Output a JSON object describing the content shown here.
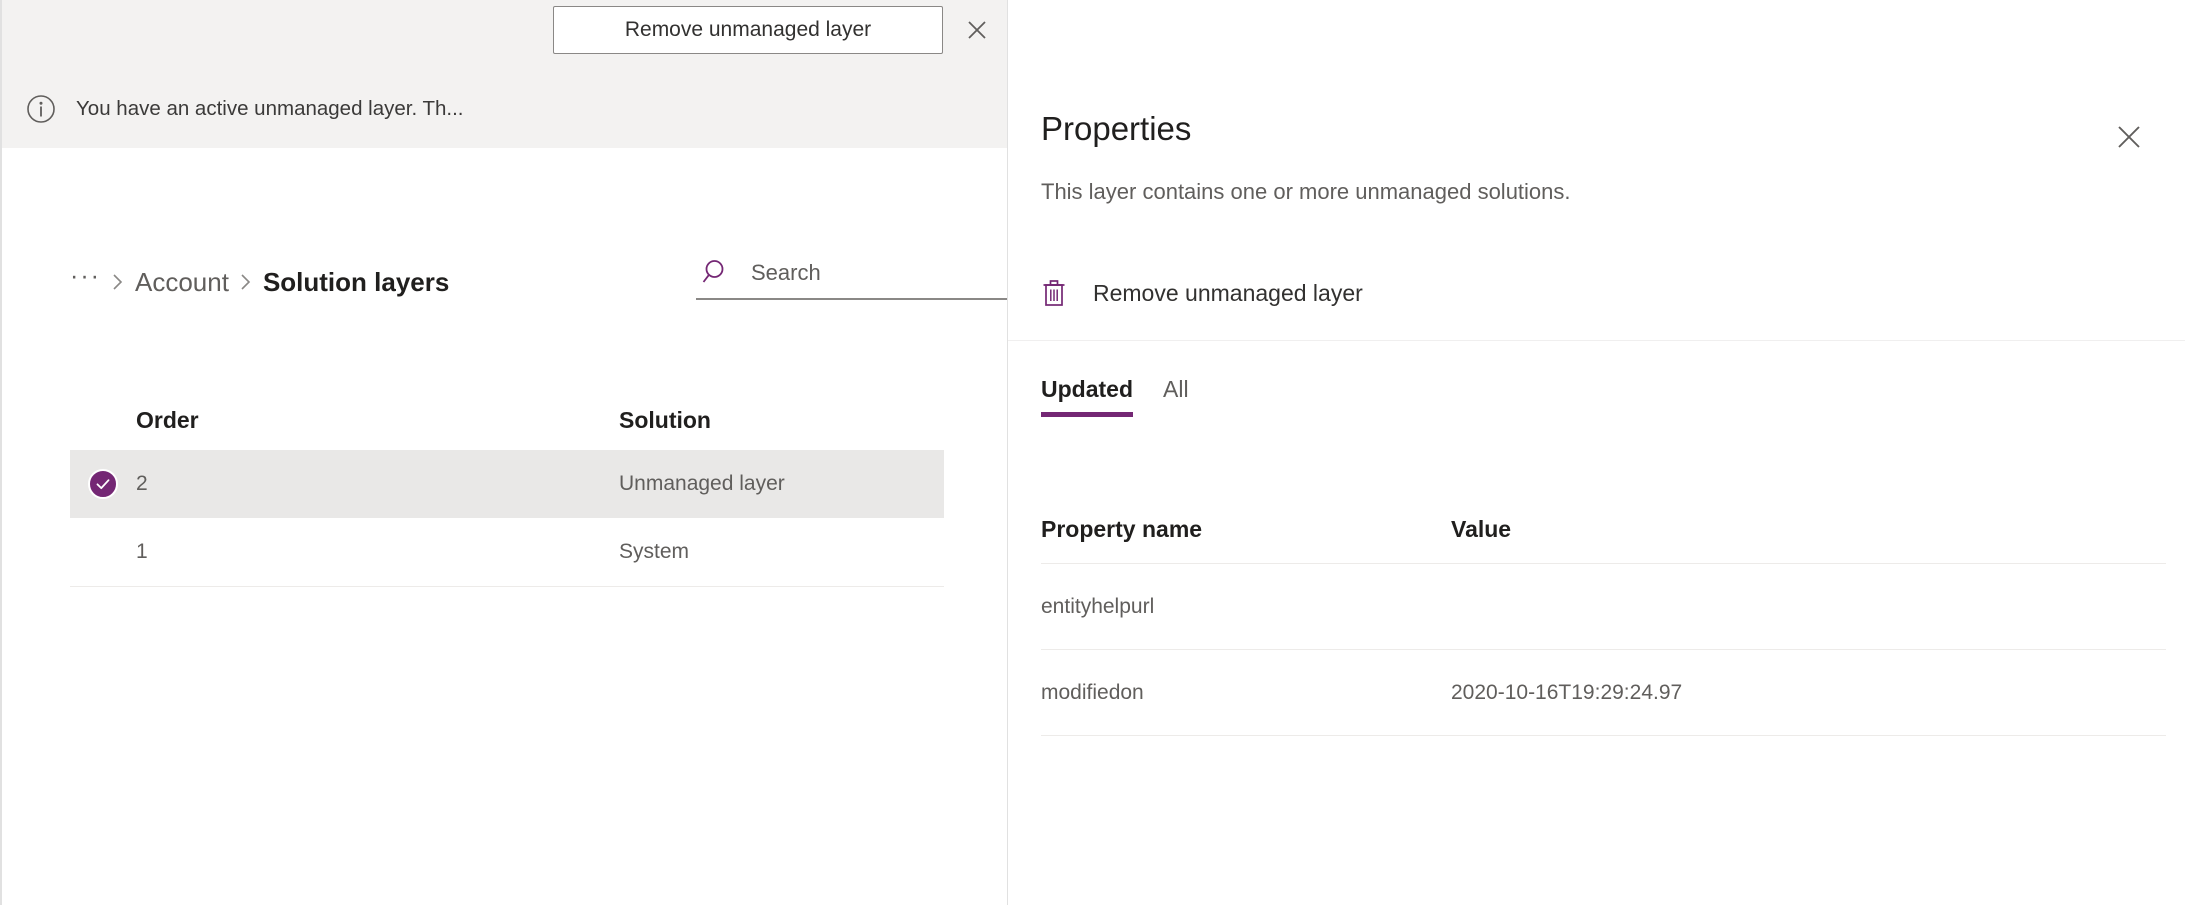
{
  "notification": {
    "icon": "info-icon",
    "message": "You have an active unmanaged layer. Th...",
    "action_label": "Remove unmanaged layer",
    "close_icon": "close-icon"
  },
  "breadcrumb": {
    "overflow": "···",
    "items": [
      {
        "label": "Account",
        "current": false
      },
      {
        "label": "Solution layers",
        "current": true
      }
    ]
  },
  "search": {
    "icon": "search-icon",
    "placeholder": "Search",
    "value": ""
  },
  "layers_grid": {
    "columns": [
      "Order",
      "Solution"
    ],
    "rows": [
      {
        "selected": true,
        "order": "2",
        "solution": "Unmanaged layer"
      },
      {
        "selected": false,
        "order": "1",
        "solution": "System"
      }
    ]
  },
  "panel": {
    "title": "Properties",
    "subtitle": "This layer contains one or more unmanaged solutions.",
    "close_icon": "close-icon",
    "action": {
      "icon": "trash-icon",
      "label": "Remove unmanaged layer"
    },
    "tabs": [
      {
        "label": "Updated",
        "active": true
      },
      {
        "label": "All",
        "active": false
      }
    ],
    "properties_table": {
      "columns": [
        "Property name",
        "Value"
      ],
      "rows": [
        {
          "name": "entityhelpurl",
          "value": ""
        },
        {
          "name": "modifiedon",
          "value": "2020-10-16T19:29:24.97"
        }
      ]
    }
  },
  "colors": {
    "accent_purple": "#742774",
    "notification_bg": "#f3f2f1",
    "row_selected_bg": "#e9e8e7",
    "border": "#edebe9",
    "text_primary": "#201f1e",
    "text_secondary": "#605e5c"
  }
}
